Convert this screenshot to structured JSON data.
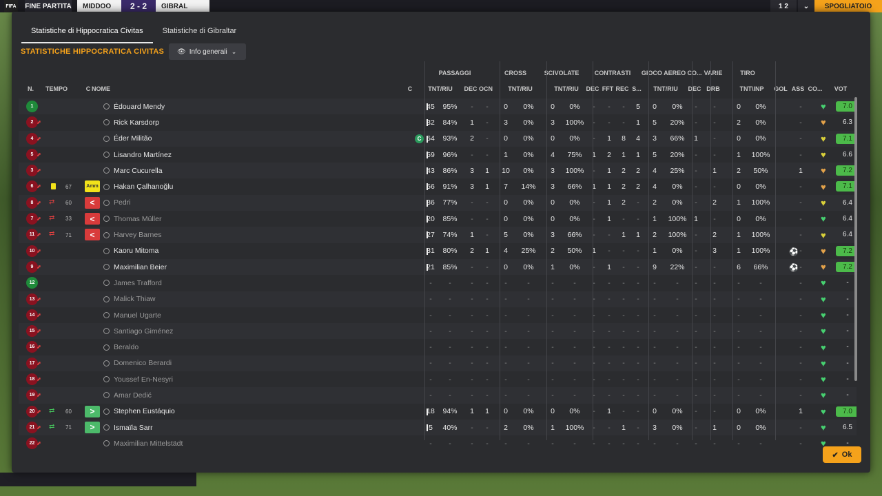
{
  "background": {
    "logo": "FIFA",
    "end_label": "FINE PARTITA",
    "team1": "MIDDOO",
    "score": "2 - 2",
    "team2": "GIBRAL",
    "right_score": "1 2",
    "right_chevron": "⌄",
    "spogliatoio": "SPOGLIATOIO"
  },
  "tabs": [
    {
      "label": "Statistiche di Hippocratica Civitas",
      "active": true
    },
    {
      "label": "Statistiche di Gibraltar",
      "active": false
    }
  ],
  "section_title": "STATISTICHE HIPPOCRATICA CIVITAS",
  "view_select": {
    "label": "Info generali"
  },
  "groups": [
    "PASSAGGI",
    "CROSS",
    "SCIVOLATE",
    "CONTRASTI",
    "GIOCO AEREO",
    "CO...",
    "VARIE",
    "TIRO"
  ],
  "headers": {
    "n": "N.",
    "tempo": "TEMPO",
    "c": "C",
    "nome": "NOME",
    "c2": "C",
    "p_tnt": "TNT/RIU",
    "p_dec": "DEC",
    "p_ocn": "OCN",
    "cr_tnt": "TNT/RIU",
    "sc_tnt": "TNT/RIU",
    "ct_dec": "DEC",
    "ct_fft": "FFT",
    "ct_rec": "REC",
    "ct_s": "S...",
    "ga_tnt": "TNT/RIU",
    "co_dec": "DEC",
    "va_drb": "DRB",
    "ti_tnt": "TNT\\INP",
    "gol": "GOL",
    "ass": "ASS",
    "co2": "CO...",
    "vot": "VOT"
  },
  "players": [
    {
      "num": "1",
      "gk": true,
      "name": "Édouard Mendy",
      "ev": "",
      "min": "",
      "badge": "",
      "cap": false,
      "dim": false,
      "mark": true,
      "v": [
        "45",
        "95%",
        "-",
        "-",
        "0",
        "0%",
        "0",
        "0%",
        "-",
        "-",
        "-",
        "5",
        "0",
        "0%",
        "-",
        "-",
        "0",
        "0%",
        "",
        "-"
      ],
      "heart": "#46d070",
      "rating": "7.0",
      "hi": true,
      "ball": false
    },
    {
      "num": "2",
      "gk": false,
      "name": "Rick Karsdorp",
      "ev": "",
      "min": "",
      "badge": "",
      "cap": false,
      "dim": false,
      "mark": true,
      "v": [
        "32",
        "84%",
        "1",
        "-",
        "3",
        "0%",
        "3",
        "100%",
        "-",
        "-",
        "-",
        "1",
        "5",
        "20%",
        "-",
        "-",
        "2",
        "0%",
        "",
        "-"
      ],
      "heart": "#e3a24a",
      "rating": "6.3",
      "hi": false,
      "ball": false
    },
    {
      "num": "4",
      "gk": false,
      "name": "Éder Militão",
      "ev": "",
      "min": "",
      "badge": "",
      "cap": true,
      "dim": false,
      "mark": true,
      "v": [
        "64",
        "93%",
        "2",
        "-",
        "0",
        "0%",
        "0",
        "0%",
        "-",
        "1",
        "8",
        "4",
        "3",
        "66%",
        "1",
        "-",
        "0",
        "0%",
        "",
        "-"
      ],
      "heart": "#d9d03a",
      "rating": "7.1",
      "hi": true,
      "ball": false
    },
    {
      "num": "5",
      "gk": false,
      "name": "Lisandro Martínez",
      "ev": "",
      "min": "",
      "badge": "",
      "cap": false,
      "dim": false,
      "mark": true,
      "v": [
        "59",
        "96%",
        "-",
        "-",
        "1",
        "0%",
        "4",
        "75%",
        "1",
        "2",
        "1",
        "1",
        "5",
        "20%",
        "-",
        "-",
        "1",
        "100%",
        "",
        "-"
      ],
      "heart": "#d9d03a",
      "rating": "6.6",
      "hi": false,
      "ball": false
    },
    {
      "num": "3",
      "gk": false,
      "name": "Marc Cucurella",
      "ev": "",
      "min": "",
      "badge": "",
      "cap": false,
      "dim": false,
      "mark": true,
      "v": [
        "43",
        "86%",
        "3",
        "1",
        "10",
        "0%",
        "3",
        "100%",
        "-",
        "1",
        "2",
        "2",
        "4",
        "25%",
        "-",
        "1",
        "2",
        "50%",
        "",
        "1"
      ],
      "heart": "#e3a24a",
      "rating": "7.2",
      "hi": true,
      "ball": false
    },
    {
      "num": "6",
      "gk": false,
      "name": "Hakan Çalhanoğlu",
      "ev": "card",
      "min": "67",
      "badge": "amm",
      "cap": false,
      "dim": false,
      "mark": true,
      "v": [
        "56",
        "91%",
        "3",
        "1",
        "7",
        "14%",
        "3",
        "66%",
        "1",
        "1",
        "2",
        "2",
        "4",
        "0%",
        "-",
        "-",
        "0",
        "0%",
        "",
        "-"
      ],
      "heart": "#e3a24a",
      "rating": "7.1",
      "hi": true,
      "ball": false
    },
    {
      "num": "8",
      "gk": false,
      "name": "Pedri",
      "ev": "out",
      "min": "60",
      "badge": "out",
      "cap": false,
      "dim": true,
      "mark": true,
      "v": [
        "36",
        "77%",
        "-",
        "-",
        "0",
        "0%",
        "0",
        "0%",
        "-",
        "1",
        "2",
        "-",
        "2",
        "0%",
        "-",
        "2",
        "1",
        "100%",
        "",
        "-"
      ],
      "heart": "#d9d03a",
      "rating": "6.4",
      "hi": false,
      "ball": false
    },
    {
      "num": "7",
      "gk": false,
      "name": "Thomas Müller",
      "ev": "out",
      "min": "33",
      "badge": "out",
      "cap": false,
      "dim": true,
      "mark": true,
      "v": [
        "20",
        "85%",
        "-",
        "-",
        "0",
        "0%",
        "0",
        "0%",
        "-",
        "1",
        "-",
        "-",
        "1",
        "100%",
        "1",
        "-",
        "0",
        "0%",
        "",
        "-"
      ],
      "heart": "#46d070",
      "rating": "6.4",
      "hi": false,
      "ball": false
    },
    {
      "num": "11",
      "gk": false,
      "name": "Harvey Barnes",
      "ev": "out",
      "min": "71",
      "badge": "out",
      "cap": false,
      "dim": true,
      "mark": true,
      "v": [
        "27",
        "74%",
        "1",
        "-",
        "5",
        "0%",
        "3",
        "66%",
        "-",
        "-",
        "1",
        "1",
        "2",
        "100%",
        "-",
        "2",
        "1",
        "100%",
        "",
        "-"
      ],
      "heart": "#d9d03a",
      "rating": "6.4",
      "hi": false,
      "ball": false
    },
    {
      "num": "10",
      "gk": false,
      "name": "Kaoru Mitoma",
      "ev": "",
      "min": "",
      "badge": "",
      "cap": false,
      "dim": false,
      "mark": true,
      "v": [
        "31",
        "80%",
        "2",
        "1",
        "4",
        "25%",
        "2",
        "50%",
        "1",
        "-",
        "-",
        "-",
        "1",
        "0%",
        "-",
        "3",
        "1",
        "100%",
        "⚽",
        "-"
      ],
      "heart": "#e3a24a",
      "rating": "7.2",
      "hi": true,
      "ball": true
    },
    {
      "num": "9",
      "gk": false,
      "name": "Maximilian Beier",
      "ev": "",
      "min": "",
      "badge": "",
      "cap": false,
      "dim": false,
      "mark": true,
      "v": [
        "21",
        "85%",
        "-",
        "-",
        "0",
        "0%",
        "1",
        "0%",
        "-",
        "1",
        "-",
        "-",
        "9",
        "22%",
        "-",
        "-",
        "6",
        "66%",
        "⚽",
        "-"
      ],
      "heart": "#e3a24a",
      "rating": "7.2",
      "hi": true,
      "ball": true
    },
    {
      "num": "12",
      "gk": true,
      "name": "James Trafford",
      "ev": "",
      "min": "",
      "badge": "",
      "cap": false,
      "dim": true,
      "mark": false,
      "v": [
        "-",
        "-",
        "-",
        "-",
        "-",
        "-",
        "-",
        "-",
        "-",
        "-",
        "-",
        "-",
        "-",
        "-",
        "-",
        "-",
        "-",
        "-",
        "",
        "-"
      ],
      "heart": "#46d070",
      "rating": "-",
      "hi": false,
      "ball": false
    },
    {
      "num": "13",
      "gk": false,
      "name": "Malick Thiaw",
      "ev": "",
      "min": "",
      "badge": "",
      "cap": false,
      "dim": true,
      "mark": false,
      "v": [
        "-",
        "-",
        "-",
        "-",
        "-",
        "-",
        "-",
        "-",
        "-",
        "-",
        "-",
        "-",
        "-",
        "-",
        "-",
        "-",
        "-",
        "-",
        "",
        "-"
      ],
      "heart": "#46d070",
      "rating": "-",
      "hi": false,
      "ball": false
    },
    {
      "num": "14",
      "gk": false,
      "name": "Manuel Ugarte",
      "ev": "",
      "min": "",
      "badge": "",
      "cap": false,
      "dim": true,
      "mark": false,
      "v": [
        "-",
        "-",
        "-",
        "-",
        "-",
        "-",
        "-",
        "-",
        "-",
        "-",
        "-",
        "-",
        "-",
        "-",
        "-",
        "-",
        "-",
        "-",
        "",
        "-"
      ],
      "heart": "#46d070",
      "rating": "-",
      "hi": false,
      "ball": false
    },
    {
      "num": "15",
      "gk": false,
      "name": "Santiago Giménez",
      "ev": "",
      "min": "",
      "badge": "",
      "cap": false,
      "dim": true,
      "mark": false,
      "v": [
        "-",
        "-",
        "-",
        "-",
        "-",
        "-",
        "-",
        "-",
        "-",
        "-",
        "-",
        "-",
        "-",
        "-",
        "-",
        "-",
        "-",
        "-",
        "",
        "-"
      ],
      "heart": "#46d070",
      "rating": "-",
      "hi": false,
      "ball": false
    },
    {
      "num": "16",
      "gk": false,
      "name": "Beraldo",
      "ev": "",
      "min": "",
      "badge": "",
      "cap": false,
      "dim": true,
      "mark": false,
      "v": [
        "-",
        "-",
        "-",
        "-",
        "-",
        "-",
        "-",
        "-",
        "-",
        "-",
        "-",
        "-",
        "-",
        "-",
        "-",
        "-",
        "-",
        "-",
        "",
        "-"
      ],
      "heart": "#46d070",
      "rating": "-",
      "hi": false,
      "ball": false
    },
    {
      "num": "17",
      "gk": false,
      "name": "Domenico Berardi",
      "ev": "",
      "min": "",
      "badge": "",
      "cap": false,
      "dim": true,
      "mark": false,
      "v": [
        "-",
        "-",
        "-",
        "-",
        "-",
        "-",
        "-",
        "-",
        "-",
        "-",
        "-",
        "-",
        "-",
        "-",
        "-",
        "-",
        "-",
        "-",
        "",
        "-"
      ],
      "heart": "#46d070",
      "rating": "-",
      "hi": false,
      "ball": false
    },
    {
      "num": "18",
      "gk": false,
      "name": "Youssef En-Nesyri",
      "ev": "",
      "min": "",
      "badge": "",
      "cap": false,
      "dim": true,
      "mark": false,
      "v": [
        "-",
        "-",
        "-",
        "-",
        "-",
        "-",
        "-",
        "-",
        "-",
        "-",
        "-",
        "-",
        "-",
        "-",
        "-",
        "-",
        "-",
        "-",
        "",
        "-"
      ],
      "heart": "#46d070",
      "rating": "-",
      "hi": false,
      "ball": false
    },
    {
      "num": "19",
      "gk": false,
      "name": "Amar Dedić",
      "ev": "",
      "min": "",
      "badge": "",
      "cap": false,
      "dim": true,
      "mark": false,
      "v": [
        "-",
        "-",
        "-",
        "-",
        "-",
        "-",
        "-",
        "-",
        "-",
        "-",
        "-",
        "-",
        "-",
        "-",
        "-",
        "-",
        "-",
        "-",
        "",
        "-"
      ],
      "heart": "#46d070",
      "rating": "-",
      "hi": false,
      "ball": false
    },
    {
      "num": "20",
      "gk": false,
      "name": "Stephen Eustáquio",
      "ev": "in",
      "min": "60",
      "badge": "in",
      "cap": false,
      "dim": false,
      "mark": true,
      "v": [
        "18",
        "94%",
        "1",
        "1",
        "0",
        "0%",
        "0",
        "0%",
        "-",
        "1",
        "-",
        "-",
        "0",
        "0%",
        "-",
        "-",
        "0",
        "0%",
        "",
        "1"
      ],
      "heart": "#46d070",
      "rating": "7.0",
      "hi": true,
      "ball": false
    },
    {
      "num": "21",
      "gk": false,
      "name": "Ismaïla Sarr",
      "ev": "in",
      "min": "71",
      "badge": "in",
      "cap": false,
      "dim": false,
      "mark": true,
      "v": [
        "5",
        "40%",
        "-",
        "-",
        "2",
        "0%",
        "1",
        "100%",
        "-",
        "-",
        "1",
        "-",
        "3",
        "0%",
        "-",
        "1",
        "0",
        "0%",
        "",
        "-"
      ],
      "heart": "#46d070",
      "rating": "6.5",
      "hi": false,
      "ball": false
    },
    {
      "num": "22",
      "gk": false,
      "name": "Maximilian Mittelstädt",
      "ev": "",
      "min": "",
      "badge": "",
      "cap": false,
      "dim": true,
      "mark": false,
      "v": [
        "-",
        "-",
        "-",
        "-",
        "-",
        "-",
        "-",
        "-",
        "-",
        "-",
        "-",
        "-",
        "-",
        "-",
        "-",
        "-",
        "-",
        "-",
        "",
        "-"
      ],
      "heart": "#46d070",
      "rating": "-",
      "hi": false,
      "ball": false
    }
  ],
  "badges": {
    "amm": "Amm",
    "out": "<",
    "in": ">"
  },
  "captain_letter": "C",
  "ok_label": "Ok",
  "colors": {
    "accent": "#f5a21b",
    "shirt_red": "#8a1220",
    "gk_green": "#1f8a3a",
    "rating_green": "#4cba4a"
  }
}
